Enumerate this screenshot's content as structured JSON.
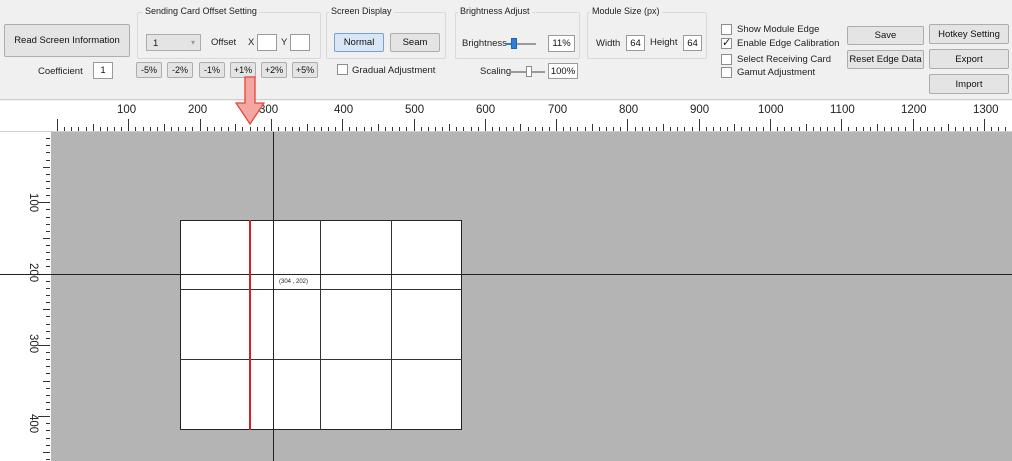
{
  "toolbar": {
    "read_screen_info": "Read Screen Information",
    "coefficient_label": "Coefficient",
    "coefficient_value": "1",
    "sending_card": {
      "title": "Sending Card Offset Setting",
      "card_value": "1",
      "offset_label": "Offset",
      "x_label": "X",
      "x_value": "",
      "y_label": "Y",
      "y_value": "",
      "step_buttons": [
        "-5%",
        "-2%",
        "-1%",
        "+1%",
        "+2%",
        "+5%"
      ]
    },
    "screen_display": {
      "title": "Screen Display",
      "normal": "Normal",
      "seam": "Seam",
      "gradual": "Gradual Adjustment",
      "gradual_checked": false
    },
    "brightness": {
      "title": "Brightness Adjust",
      "brightness_label": "Brightness",
      "brightness_value": "11%",
      "brightness_level": 0.11,
      "scaling_label": "Scaling",
      "scaling_value": "100%",
      "scaling_level": 1.0
    },
    "module_size": {
      "title": "Module Size (px)",
      "width_label": "Width",
      "width_value": "64",
      "height_label": "Height",
      "height_value": "64"
    },
    "options": [
      {
        "label": "Show Module Edge",
        "checked": false
      },
      {
        "label": "Enable Edge Calibration",
        "checked": true
      },
      {
        "label": "Select Receiving Card",
        "checked": false
      },
      {
        "label": "Gamut Adjustment",
        "checked": false
      }
    ],
    "save": "Save",
    "reset_edge_data": "Reset Edge Data",
    "hotkey_setting": "Hotkey Setting",
    "export": "Export",
    "import": "Import"
  },
  "ruler": {
    "horizontal_labels": [
      "100",
      "200",
      "300",
      "400",
      "500",
      "600",
      "700",
      "800",
      "900",
      "1000",
      "1100",
      "1200",
      "1300"
    ],
    "vertical_labels": [
      "100",
      "200",
      "300",
      "400"
    ]
  },
  "canvas": {
    "coordinate_readout": "(304 , 202)"
  },
  "colors": {
    "workspace": "#b4b4b4",
    "accent": "#2f7ed8",
    "calibration_line": "#d81e1e",
    "pointer_arrow": "#f4a6a0"
  }
}
